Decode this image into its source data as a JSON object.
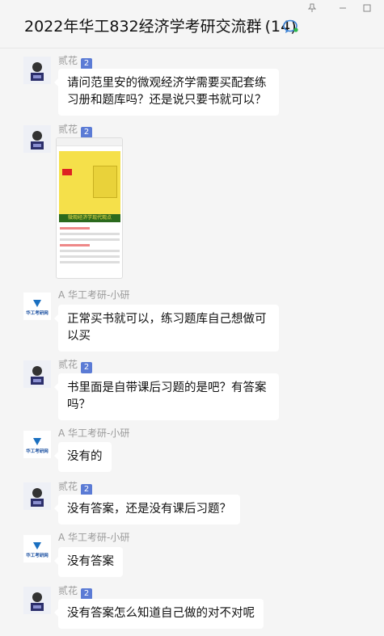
{
  "header": {
    "title": "2022年华工832经济学考研交流群",
    "count": "(14)",
    "icons": [
      "pin-icon",
      "minimize-icon",
      "maximize-icon",
      "chat-bubble-icon"
    ]
  },
  "senders": {
    "a": {
      "name": "贰花",
      "badge": "2"
    },
    "b": {
      "name": "A 华工考研-小研"
    }
  },
  "avatar_b_text": "华工考研网",
  "image_message": {
    "band_text": "微观经济学现代观点"
  },
  "messages": [
    {
      "text": "请问范里安的微观经济学需要买配套练习册和题库吗？还是说只要书就可以？"
    },
    {
      "text": ""
    },
    {
      "text": "正常买书就可以，练习题库自己想做可以买"
    },
    {
      "text": "书里面是自带课后习题的是吧？有答案吗？"
    },
    {
      "text": "没有的"
    },
    {
      "text": "没有答案，还是没有课后习题？"
    },
    {
      "text": "没有答案"
    },
    {
      "text": "没有答案怎么知道自己做的对不对呢"
    }
  ]
}
